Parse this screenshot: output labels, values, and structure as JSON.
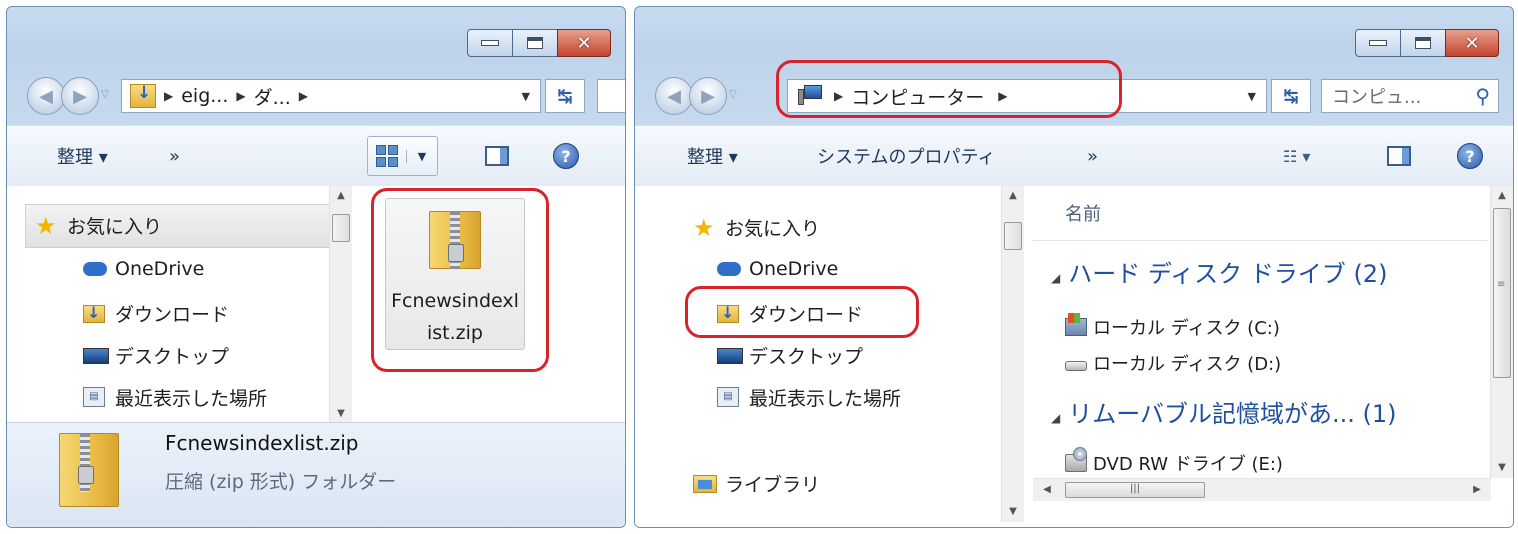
{
  "left_window": {
    "address": {
      "seg1": "eig...",
      "seg2": "ダ..."
    },
    "toolbar": {
      "organize": "整理 ▾",
      "more": "»"
    },
    "nav": {
      "favorites": "お気に入り",
      "onedrive": "OneDrive",
      "downloads": "ダウンロード",
      "desktop": "デスクトップ",
      "recent": "最近表示した場所"
    },
    "file": {
      "tile_label": "Fcnewsindexlist.zip"
    },
    "details": {
      "name": "Fcnewsindexlist.zip",
      "type": "圧縮 (zip 形式) フォルダー"
    }
  },
  "right_window": {
    "address": {
      "seg1": "コンピューター"
    },
    "search": {
      "placeholder": "コンピュ..."
    },
    "toolbar": {
      "organize": "整理 ▾",
      "system_properties": "システムのプロパティ",
      "more": "»"
    },
    "nav": {
      "favorites": "お気に入り",
      "onedrive": "OneDrive",
      "downloads": "ダウンロード",
      "desktop": "デスクトップ",
      "recent": "最近表示した場所",
      "libraries": "ライブラリ"
    },
    "column_name": "名前",
    "groups": {
      "hdd": "ハード ディスク ドライブ (2)",
      "removable": "リムーバブル記憶域があ... (1)"
    },
    "drives": {
      "c": "ローカル ディスク (C:)",
      "d": "ローカル ディスク (D:)",
      "e": "DVD RW ドライブ (E:)"
    }
  },
  "colors": {
    "highlight_border": "#d8232a",
    "group_text": "#1f4fa0",
    "frame": "#c7dbf0"
  }
}
